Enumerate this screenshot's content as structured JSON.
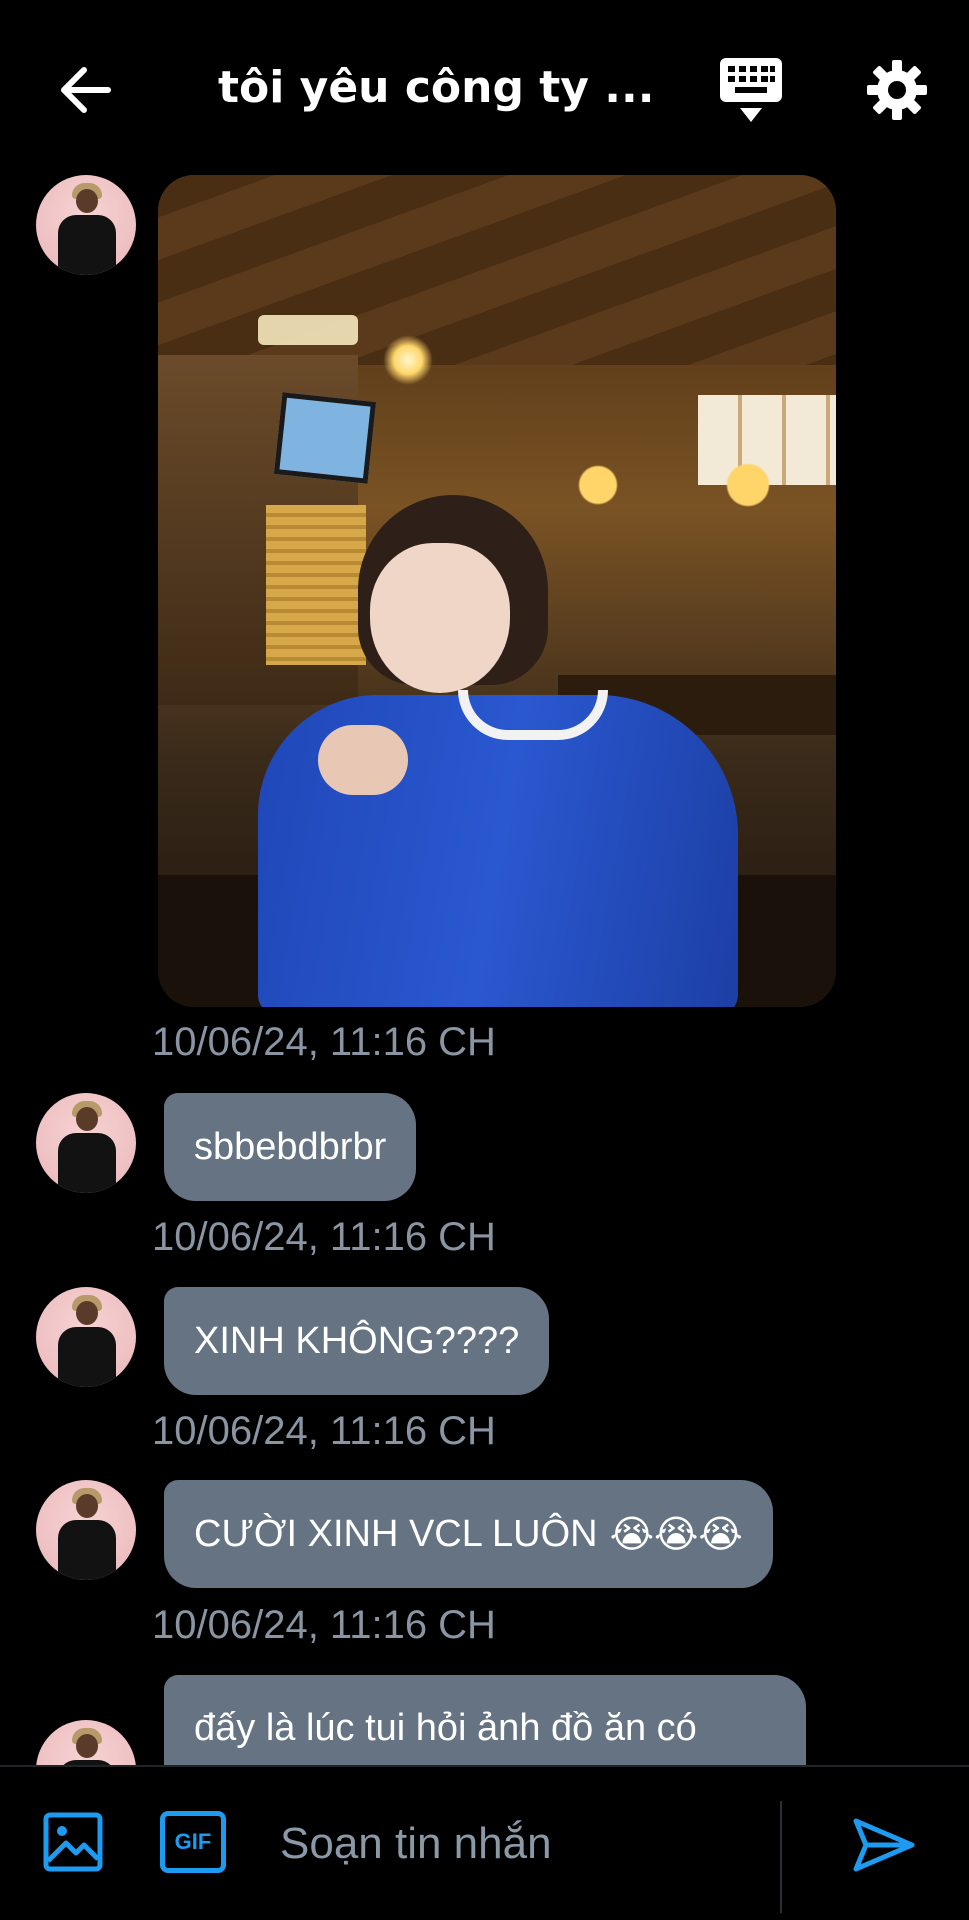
{
  "header": {
    "title": "tôi yêu công ty ...",
    "back_icon": "arrow-left-icon",
    "keyboard_icon": "keyboard-icon",
    "settings_icon": "gear-icon"
  },
  "messages": [
    {
      "type": "image",
      "timestamp": "10/06/24, 11:16 CH"
    },
    {
      "type": "text",
      "text": "sbbebdbrbr",
      "timestamp": "10/06/24, 11:16 CH"
    },
    {
      "type": "text",
      "text": "XINH KHÔNG????",
      "timestamp": "10/06/24, 11:16 CH"
    },
    {
      "type": "text",
      "text": "CƯỜI XINH VCL LUÔN",
      "emoji": "😭😭😭",
      "timestamp": "10/06/24, 11:16 CH"
    },
    {
      "type": "text",
      "text": "đấy là lúc tui hỏi ảnh đồ ăn có"
    }
  ],
  "composer": {
    "image_icon": "image-icon",
    "gif_label": "GIF",
    "placeholder": "Soạn tin nhắn",
    "send_icon": "send-icon"
  },
  "colors": {
    "background": "#000000",
    "bubble": "#657383",
    "timestamp": "#8a95a3",
    "accent": "#1d9bf0"
  }
}
